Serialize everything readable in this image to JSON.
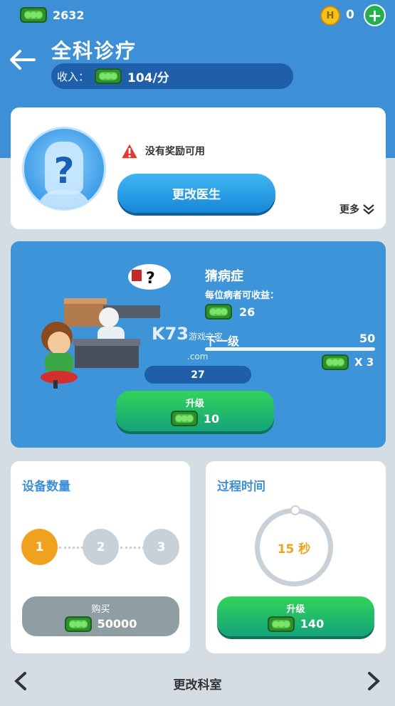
{
  "top_bar": {
    "cash": "2632",
    "coins": "0",
    "coin_glyph": "H"
  },
  "header": {
    "title": "全科诊疗",
    "income_label": "收入：",
    "income_value": "104/分"
  },
  "doctor": {
    "warning_text": "没有奖励可用",
    "change_button": "更改医生",
    "more_label": "更多"
  },
  "room": {
    "name": "猜病症",
    "per_patient_label": "每位病者可收益：",
    "earn_per_patient": "26",
    "next_level_label": "下一级",
    "next_level_value": "50",
    "multiplier": "X 3",
    "level": "27",
    "upgrade_label": "升级",
    "upgrade_cost": "10"
  },
  "equipment": {
    "title": "设备数量",
    "dots": [
      "1",
      "2",
      "3"
    ],
    "buy_label": "购买",
    "buy_cost": "50000"
  },
  "process": {
    "title": "过程时间",
    "time": "15 秒",
    "upgrade_label": "升级",
    "upgrade_cost": "140"
  },
  "bottom_nav": {
    "title": "更改科室"
  },
  "watermark": {
    "main": "K73",
    "sub1": "游戏之家",
    "sub2": ".com"
  },
  "colors": {
    "header_blue": "#3d8fd6",
    "accent_orange": "#f0a21f",
    "green_button": "#22b14c"
  }
}
